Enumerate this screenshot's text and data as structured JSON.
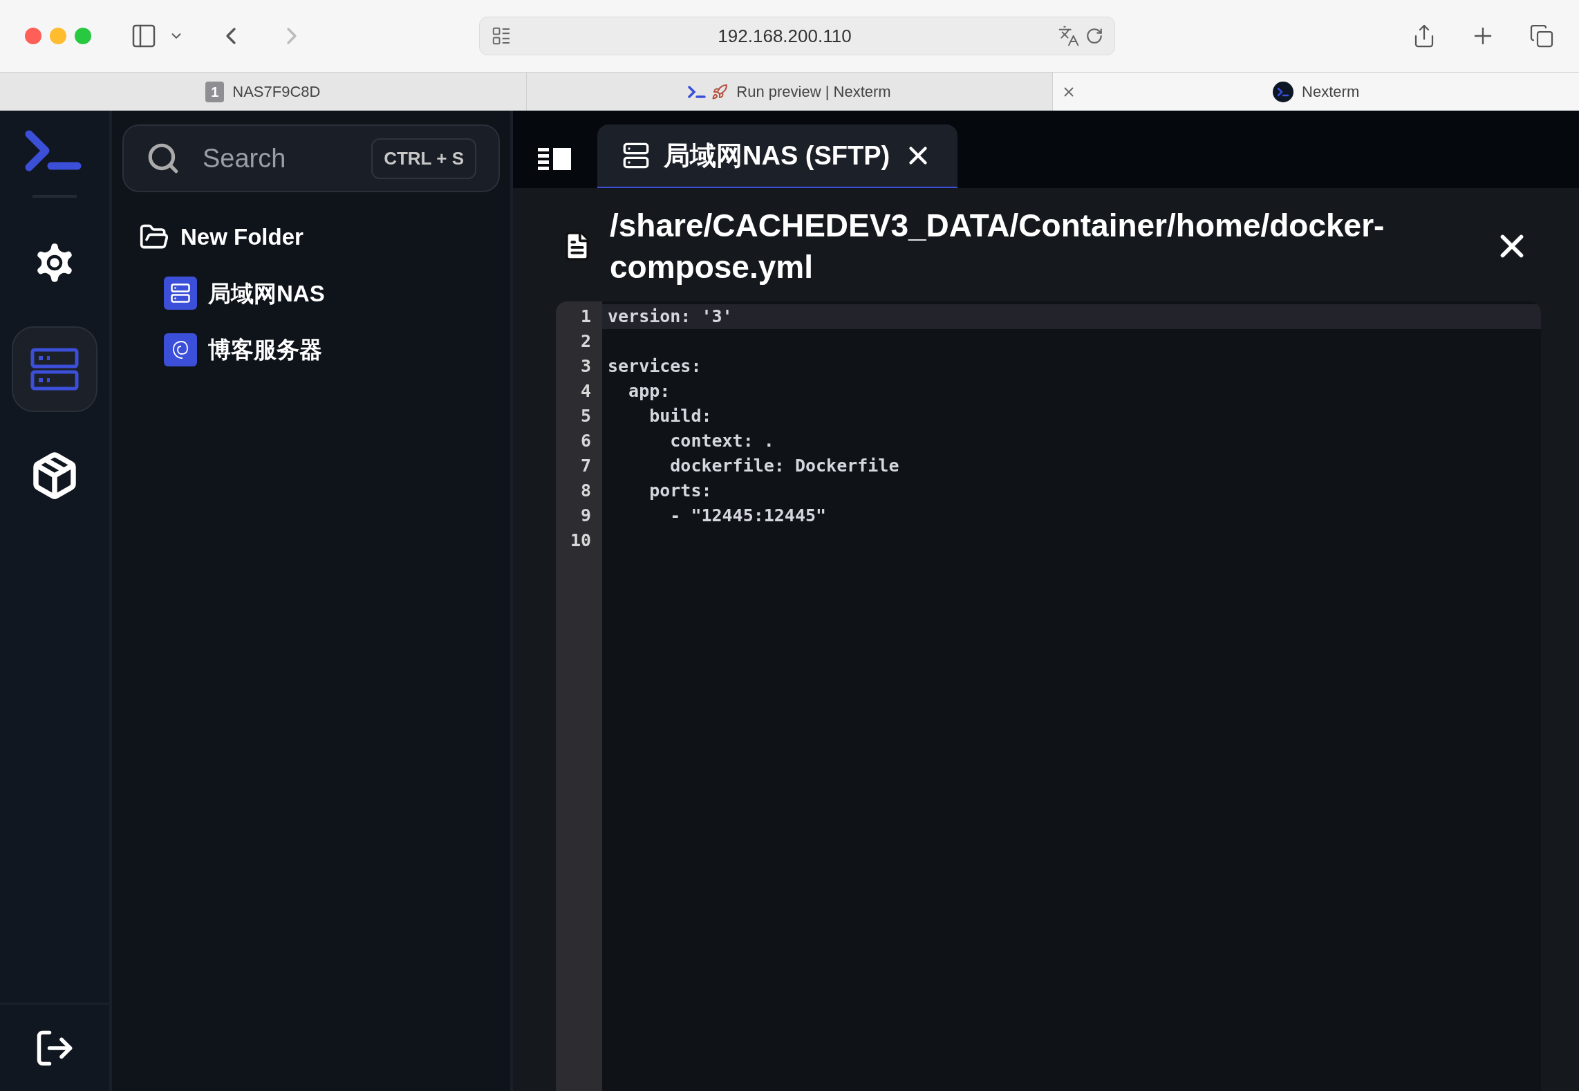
{
  "browser": {
    "url": "192.168.200.110",
    "tabs": [
      {
        "badge": "1",
        "title": "NAS7F9C8D",
        "selected": false,
        "kind": "badge"
      },
      {
        "title": "Run preview | Nexterm",
        "selected": false,
        "kind": "rocket"
      },
      {
        "title": "Nexterm",
        "selected": true,
        "kind": "logo"
      }
    ]
  },
  "rail": {
    "items": [
      {
        "kind": "settings",
        "selected": false
      },
      {
        "kind": "servers",
        "selected": true
      },
      {
        "kind": "apps",
        "selected": false
      }
    ]
  },
  "sidebar": {
    "search": {
      "placeholder": "Search",
      "shortcut": "CTRL + S"
    },
    "tree": [
      {
        "name": "New Folder",
        "kind": "folder",
        "expanded": true,
        "children": [
          {
            "name": "局域网NAS",
            "kind": "server"
          },
          {
            "name": "博客服务器",
            "kind": "debian"
          }
        ]
      }
    ]
  },
  "tabs": [
    {
      "label": "局域网NAS (SFTP)",
      "selected": true
    }
  ],
  "editor": {
    "path": "/share/CACHEDEV3_DATA/Container/home/docker-compose.yml",
    "lines": [
      {
        "number": "1",
        "text": "version: '3'",
        "selected": true
      },
      {
        "number": "2",
        "selected": false
      },
      {
        "number": "3",
        "text": "services:",
        "selected": false
      },
      {
        "number": "4",
        "text": "  app:",
        "selected": false
      },
      {
        "number": "5",
        "text": "    build:",
        "selected": false
      },
      {
        "number": "6",
        "text": "      context: .",
        "selected": false
      },
      {
        "number": "7",
        "text": "      dockerfile: Dockerfile",
        "selected": false
      },
      {
        "number": "8",
        "text": "    ports:",
        "selected": false
      },
      {
        "number": "9",
        "text": "      - \"12445:12445\"",
        "selected": false
      },
      {
        "number": "10",
        "selected": false
      }
    ]
  }
}
